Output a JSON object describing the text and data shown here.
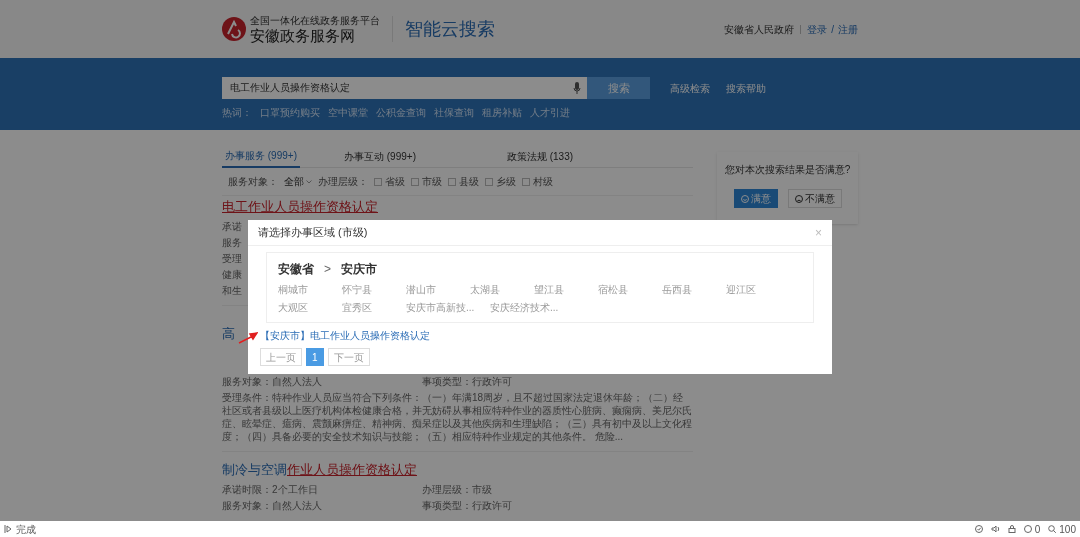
{
  "header": {
    "platform": "全国一体化在线政务服务平台",
    "site": "安徽政务服务网",
    "product": "智能云搜索",
    "links": [
      {
        "label": "安徽省人民政府",
        "kind": "text"
      },
      {
        "label": "登录",
        "kind": "link"
      },
      {
        "label": "/",
        "kind": "sep"
      },
      {
        "label": "注册",
        "kind": "link"
      }
    ]
  },
  "search": {
    "value": "电工作业人员操作资格认定",
    "button": "搜索",
    "links": [
      "高级检索",
      "搜索帮助"
    ],
    "hot_label": "热词：",
    "hot_words": [
      "口罩预约购买",
      "空中课堂",
      "公积金查询",
      "社保查询",
      "租房补贴",
      "人才引进"
    ]
  },
  "tabs": [
    {
      "label": "办事服务 (999+)",
      "selected": true
    },
    {
      "label": "办事互动 (999+)",
      "selected": false
    },
    {
      "label": "政策法规 (133)",
      "selected": false
    }
  ],
  "filters": {
    "object_label": "服务对象：",
    "object_value": "全部",
    "level_label": "办理层级：",
    "levels": [
      {
        "label": "省级",
        "checked": false
      },
      {
        "label": "市级",
        "checked": false
      },
      {
        "label": "县级",
        "checked": false
      },
      {
        "label": "乡级",
        "checked": false
      },
      {
        "label": "村级",
        "checked": false
      }
    ]
  },
  "results": [
    {
      "title": [
        {
          "text": "电工作业人员操作资格认定",
          "match": true
        }
      ],
      "lines": [
        [
          "承诺"
        ],
        [
          "服务"
        ],
        [
          "受理"
        ],
        [
          "健康"
        ],
        [
          "和生"
        ]
      ]
    },
    {
      "title": [
        {
          "text": "高",
          "match": false
        }
      ],
      "lines": [
        [
          "服务对象：自然人法人",
          "事项类型：行政许可"
        ],
        [
          "受理条件：特种作业人员应当符合下列条件：（一）年满18周岁，且不超过国家法定退休年龄；（二）经社区或者县级以上医疗机构体检健康合格，并无妨碍从事相应特种作业的器质性心脏病、癫痫病、美尼尔氏症、眩晕症、癔病、震颤麻痹症、精神病、痴呆症以及其他疾病和生理缺陷；（三）具有初中及以上文化程度；（四）具备必要的安全技术知识与技能；（五）相应特种作业规定的其他条件。 危险..."
        ]
      ]
    },
    {
      "title": [
        {
          "text": "制冷与空调",
          "match": false
        },
        {
          "text": "作业人员操作资格认定",
          "match": true
        }
      ],
      "lines": [
        [
          "承诺时限：2个工作日",
          "办理层级：市级"
        ],
        [
          "服务对象：自然人法人",
          "事项类型：行政许可"
        ]
      ]
    }
  ],
  "feedback": {
    "question": "您对本次搜索结果是否满意?",
    "buttons": [
      {
        "label": "满意",
        "kind": "primary"
      },
      {
        "label": "不满意",
        "kind": "default"
      }
    ]
  },
  "dialog": {
    "title": "请选择办事区域 (市级)",
    "close": "×",
    "breadcrumb": [
      "安徽省",
      "安庆市"
    ],
    "separator": ">",
    "areas": [
      "桐城市",
      "怀宁县",
      "潜山市",
      "太湖县",
      "望江县",
      "宿松县",
      "岳西县",
      "迎江区",
      "大观区",
      "宜秀区",
      "安庆市高新技...",
      "安庆经济技术..."
    ],
    "result": "【安庆市】电工作业人员操作资格认定",
    "pagination": [
      {
        "label": "上一页",
        "selected": false
      },
      {
        "label": "1",
        "selected": true
      },
      {
        "label": "下一页",
        "selected": false
      }
    ]
  },
  "status_bar": {
    "text": "完成",
    "counter": "0",
    "zoom": "100"
  }
}
